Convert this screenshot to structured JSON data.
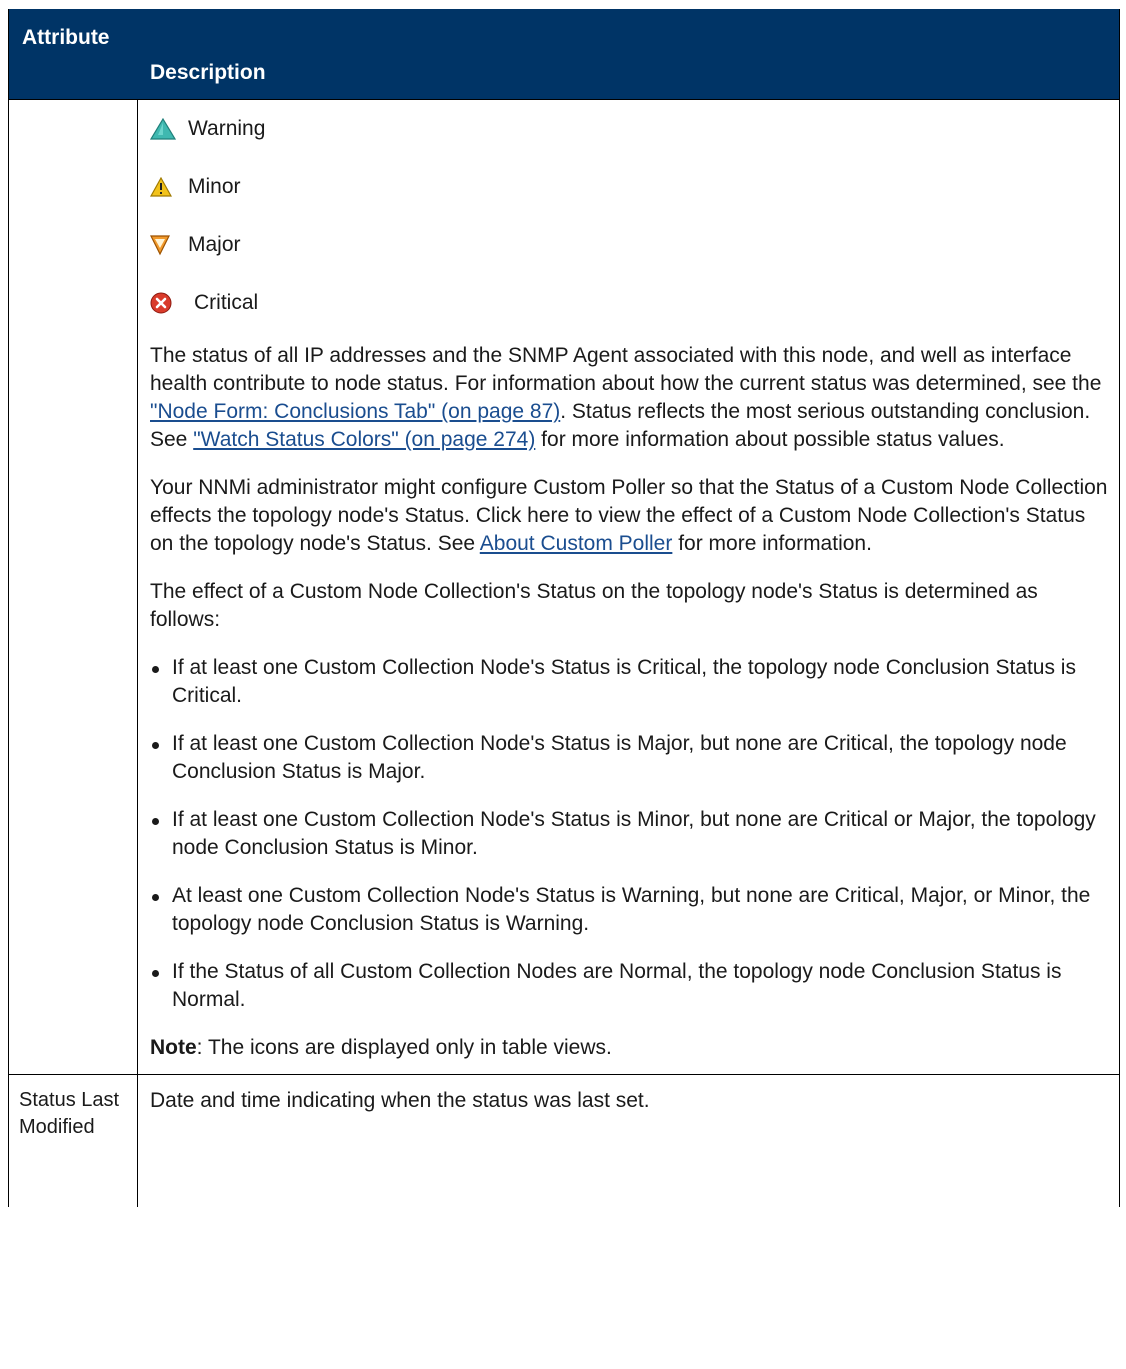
{
  "header": {
    "attribute": "Attribute",
    "description": "Description"
  },
  "status_items": [
    {
      "label": "Warning",
      "icon": "warning-triangle-icon",
      "color": "#3fb8b0"
    },
    {
      "label": "Minor",
      "icon": "minor-warning-icon",
      "color": "#f2c21b"
    },
    {
      "label": "Major",
      "icon": "major-down-triangle-icon",
      "color": "#f19a2c"
    },
    {
      "label": "Critical",
      "icon": "critical-x-icon",
      "color": "#d93b2b"
    }
  ],
  "para1": {
    "text1": "The status of all IP addresses and the SNMP Agent associated with this node, and well as interface health contribute to node status. For information about how the current status was determined, see the ",
    "link1": "\"Node Form: Conclusions Tab\" (on page 87)",
    "text2": ". Status reflects the most serious outstanding conclusion. See ",
    "link2": "\"Watch Status Colors\" (on page 274)",
    "text3": " for more information about possible status values."
  },
  "para2": {
    "text1": "Your NNMi administrator might configure Custom Poller so that the Status of a Custom Node Collection effects the topology node's Status. Click here to view the effect of a Custom Node Collection's Status on the topology node's Status. See ",
    "link": "About Custom Poller",
    "text2": " for more information."
  },
  "para3": "The effect of a Custom Node Collection's Status on the topology node's Status is determined as follows:",
  "bullets": [
    "If at least one Custom Collection Node's Status is Critical, the topology node Conclusion Status is Critical.",
    "If at least one Custom Collection Node's Status is Major, but none are Critical, the topology node Conclusion Status is Major.",
    "If at least one Custom Collection Node's Status is Minor, but none are Critical or Major, the topology node Conclusion Status is Minor.",
    "At least one Custom Collection Node's Status is Warning, but none are Critical, Major, or Minor, the topology node Conclusion Status is Warning.",
    "If the Status of all Custom Collection Nodes are Normal, the topology node Conclusion Status is Normal."
  ],
  "note": {
    "label": "Note",
    "text": ": The icons are displayed only in table views."
  },
  "row2": {
    "attribute": "Status Last Modified",
    "description": "Date and time indicating when the status was last set."
  }
}
